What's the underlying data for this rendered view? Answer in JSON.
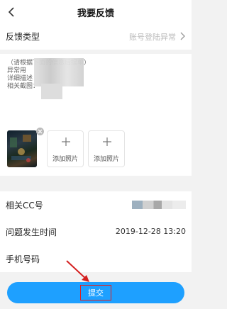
{
  "header": {
    "title": "我要反馈",
    "back_icon": "chevron-left-icon"
  },
  "feedback_type": {
    "label": "反馈类型",
    "value": "账号登陆异常"
  },
  "description": {
    "lines": [
      "（请根据下面的信息后提单）",
      "异常用",
      "详细描述",
      "相关截图："
    ]
  },
  "photos": {
    "add_label_1": "添加照片",
    "add_label_2": "添加照片"
  },
  "fields": {
    "cc_label": "相关CC号",
    "time_label": "问题发生时间",
    "time_value": "2019-12-28 13:20",
    "phone_label": "手机号码"
  },
  "submit": {
    "label": "提交"
  },
  "colors": {
    "accent": "#1ea0ff",
    "highlight": "#e02020"
  }
}
